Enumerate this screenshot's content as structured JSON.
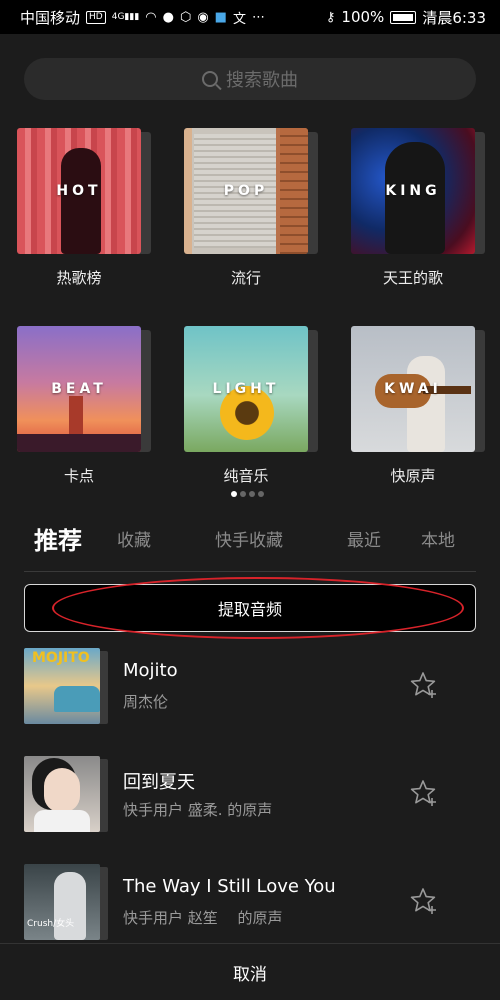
{
  "status_bar": {
    "carrier": "中国移动",
    "hd": "HD",
    "network": "4G",
    "battery": "100%",
    "time": "清晨6:33"
  },
  "search": {
    "placeholder": "搜索歌曲"
  },
  "categories": [
    {
      "cover_text": "HOT",
      "label": "热歌榜"
    },
    {
      "cover_text": "POP",
      "label": "流行"
    },
    {
      "cover_text": "KING",
      "label": "天王的歌"
    },
    {
      "cover_text": "BEAT",
      "label": "卡点"
    },
    {
      "cover_text": "LIGHT",
      "label": "纯音乐"
    },
    {
      "cover_text": "KWAI",
      "label": "快原声"
    }
  ],
  "pager": {
    "pages": 4,
    "active": 0
  },
  "tabs": [
    {
      "label": "推荐",
      "active": true
    },
    {
      "label": "收藏",
      "active": false
    },
    {
      "label": "快手收藏",
      "active": false
    },
    {
      "label": "最近",
      "active": false
    },
    {
      "label": "本地",
      "active": false
    }
  ],
  "extract_button": {
    "label": "提取音频"
  },
  "songs": [
    {
      "title": "Mojito",
      "subtitle": "周杰伦",
      "thumb_text": "MOJITO"
    },
    {
      "title": "回到夏天",
      "subtitle": "快手用户 盛柔. 的原声",
      "thumb_text": ""
    },
    {
      "title": "The Way I Still Love You",
      "subtitle": "快手用户 赵笙　 的原声",
      "thumb_text": "Crush/女头"
    }
  ],
  "footer": {
    "cancel_label": "取消"
  },
  "colors": {
    "background": "#1c1c1c",
    "annotation": "#d8232a",
    "muted_text": "#9a9a9a"
  }
}
